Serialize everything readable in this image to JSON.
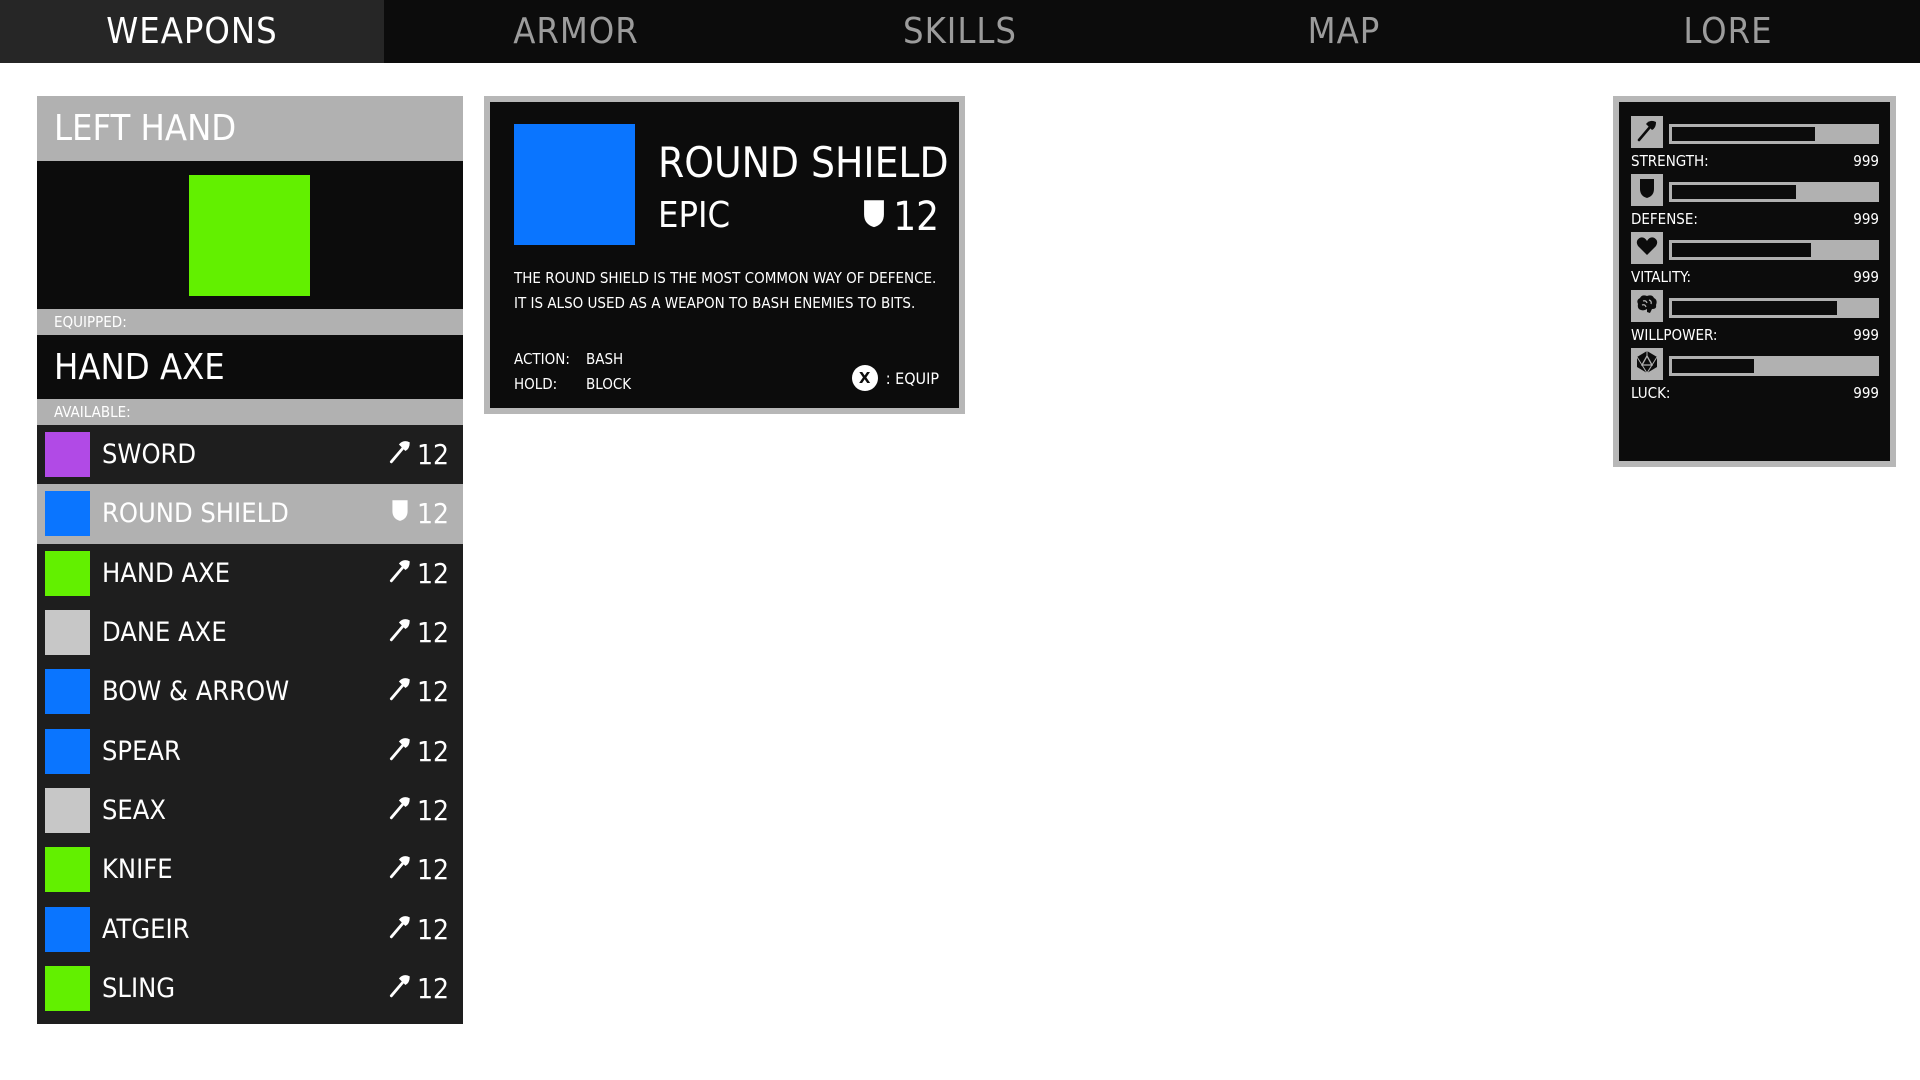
{
  "nav": {
    "tabs": [
      {
        "label": "WEAPONS",
        "active": true
      },
      {
        "label": "ARMOR",
        "active": false
      },
      {
        "label": "SKILLS",
        "active": false
      },
      {
        "label": "MAP",
        "active": false
      },
      {
        "label": "LORE",
        "active": false
      }
    ]
  },
  "left_panel": {
    "title": "LEFT HAND",
    "preview_color": "#62f000",
    "equipped_label": "EQUIPPED:",
    "equipped_name": "HAND AXE",
    "available_label": "AVAILABLE:",
    "items": [
      {
        "name": "SWORD",
        "color": "#b14ae6",
        "stat_icon": "axe-icon",
        "stat": "12",
        "selected": false
      },
      {
        "name": "ROUND SHIELD",
        "color": "#0a75ff",
        "stat_icon": "shield-icon",
        "stat": "12",
        "selected": true
      },
      {
        "name": "HAND AXE",
        "color": "#62f000",
        "stat_icon": "axe-icon",
        "stat": "12",
        "selected": false
      },
      {
        "name": "DANE AXE",
        "color": "#c7c7c7",
        "stat_icon": "axe-icon",
        "stat": "12",
        "selected": false
      },
      {
        "name": "BOW & ARROW",
        "color": "#0a75ff",
        "stat_icon": "axe-icon",
        "stat": "12",
        "selected": false
      },
      {
        "name": "SPEAR",
        "color": "#0a75ff",
        "stat_icon": "axe-icon",
        "stat": "12",
        "selected": false
      },
      {
        "name": "SEAX",
        "color": "#c7c7c7",
        "stat_icon": "axe-icon",
        "stat": "12",
        "selected": false
      },
      {
        "name": "KNIFE",
        "color": "#62f000",
        "stat_icon": "axe-icon",
        "stat": "12",
        "selected": false
      },
      {
        "name": "ATGEIR",
        "color": "#0a75ff",
        "stat_icon": "axe-icon",
        "stat": "12",
        "selected": false
      },
      {
        "name": "SLING",
        "color": "#62f000",
        "stat_icon": "axe-icon",
        "stat": "12",
        "selected": false
      }
    ]
  },
  "detail": {
    "color": "#0a75ff",
    "name": "ROUND SHIELD",
    "rarity": "EPIC",
    "stat_icon": "shield-icon",
    "stat": "12",
    "description_line1": "THE ROUND SHIELD IS THE MOST COMMON WAY OF DEFENCE.",
    "description_line2": "IT IS ALSO USED AS A WEAPON TO BASH ENEMIES TO BITS.",
    "action_key": "ACTION:",
    "action_value": "BASH",
    "hold_key": "HOLD:",
    "hold_value": "BLOCK",
    "equip_button": "X",
    "equip_label": ": EQUIP"
  },
  "stats": [
    {
      "icon": "axe-icon",
      "label": "STRENGTH:",
      "value": "999",
      "level": 0.7
    },
    {
      "icon": "shield-icon",
      "label": "DEFENSE:",
      "value": "999",
      "level": 0.61
    },
    {
      "icon": "heart-icon",
      "label": "VITALITY:",
      "value": "999",
      "level": 0.68
    },
    {
      "icon": "brain-icon",
      "label": "WILLPOWER:",
      "value": "999",
      "level": 0.81
    },
    {
      "icon": "d20-icon",
      "label": "LUCK:",
      "value": "999",
      "level": 0.4
    }
  ],
  "colors": {
    "panel_dark": "#0c0c0c",
    "panel_mid": "#1e1e1e",
    "panel_light": "#b1b1b1",
    "active_tab": "#262626"
  }
}
